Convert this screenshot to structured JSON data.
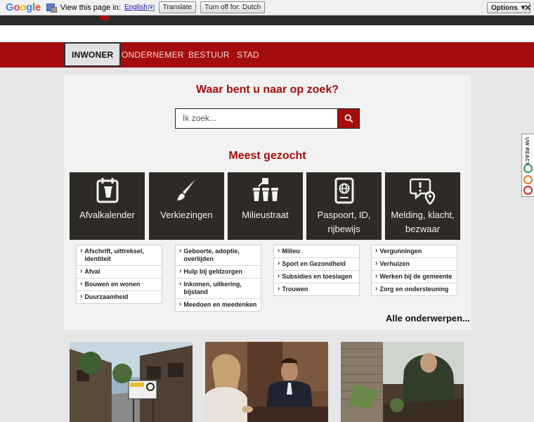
{
  "translate_bar": {
    "logo": [
      "G",
      "o",
      "o",
      "g",
      "l",
      "e"
    ],
    "view_text": "View this page in:",
    "language": "English",
    "translate_label": "Translate",
    "turn_off_label": "Turn off for: Dutch",
    "options_label": "Options ▼",
    "close_symbol": "✕"
  },
  "nav": {
    "items": [
      {
        "label": "INWONER",
        "active": true
      },
      {
        "label": "ONDERNEMER",
        "active": false
      },
      {
        "label": "BESTUUR",
        "active": false
      },
      {
        "label": "STAD",
        "active": false
      }
    ]
  },
  "main": {
    "search_heading": "Waar bent u naar op zoek?",
    "search_placeholder": "Ik zoek...",
    "most_searched_heading": "Meest gezocht",
    "tiles": [
      {
        "label": "Afvalkalender",
        "icon": "calendar-icon"
      },
      {
        "label": "Verkiezingen",
        "icon": "pen-brush-icon"
      },
      {
        "label": "Milieustraat",
        "icon": "recycling-containers-icon"
      },
      {
        "label": "Paspoort, ID, rijbewijs",
        "icon": "passport-icon"
      },
      {
        "label": "Melding, klacht, bezwaar",
        "icon": "report-location-icon"
      }
    ],
    "link_columns": [
      [
        "Afschrift, uittreksel, identiteit",
        "Afval",
        "Bouwen en wonen",
        "Duurzaamheid"
      ],
      [
        "Geboorte, adoptie, overlijden",
        "Hulp bij geldzorgen",
        "Inkomen, uitkering, bijstand",
        "Meedoen en meedenken"
      ],
      [
        "Milieu",
        "Sport en Gezondheid",
        "Subsidies en toeslagen",
        "Trouwen"
      ],
      [
        "Vergunningen",
        "Verhuizen",
        "Werken bij de gemeente",
        "Zorg en ondersteuning"
      ]
    ],
    "all_subjects": "Alle onderwerpen..."
  },
  "feedback": {
    "label": "UW REACTIE"
  },
  "colors": {
    "brand_red": "#a50d0d",
    "tile_dark": "#2e2a26"
  }
}
